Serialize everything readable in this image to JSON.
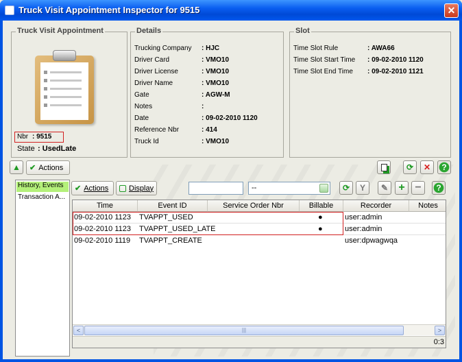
{
  "window": {
    "title": "Truck Visit Appointment Inspector for 9515",
    "close_glyph": "✕"
  },
  "appointment": {
    "legend": "Truck Visit Appointment",
    "nbr_label": "Nbr",
    "nbr_value": ": 9515",
    "state_label": "State",
    "state_value": ": UsedLate"
  },
  "details": {
    "legend": "Details",
    "fields": [
      {
        "label": "Trucking Company",
        "value": ": HJC"
      },
      {
        "label": "Driver Card",
        "value": ": VMO10"
      },
      {
        "label": "Driver License",
        "value": ": VMO10"
      },
      {
        "label": "Driver Name",
        "value": ": VMO10"
      },
      {
        "label": "Gate",
        "value": ": AGW-M"
      },
      {
        "label": "Notes",
        "value": ":"
      },
      {
        "label": "Date",
        "value": ": 09-02-2010 1120"
      },
      {
        "label": "Reference Nbr",
        "value": ": 414"
      },
      {
        "label": "Truck Id",
        "value": ": VMO10"
      }
    ]
  },
  "slot": {
    "legend": "Slot",
    "fields": [
      {
        "label": "Time Slot Rule",
        "value": ": AWA66"
      },
      {
        "label": "Time Slot Start Time",
        "value": ": 09-02-2010 1120"
      },
      {
        "label": "Time Slot End Time",
        "value": ": 09-02-2010 1121"
      }
    ]
  },
  "toolbar": {
    "collapse_glyph": "▲",
    "actions_label": "Actions",
    "refresh_glyph": "⟳",
    "delete_glyph": "✕",
    "help_glyph": "?"
  },
  "nav": {
    "items": [
      {
        "label": "History, Events"
      },
      {
        "label": "Transaction A..."
      }
    ]
  },
  "panel_toolbar": {
    "actions_label": "Actions",
    "display_label": "Display",
    "filter_value": "",
    "combo_value": "--",
    "refresh_glyph": "⟳",
    "filter_glyph": "Y",
    "edit_glyph": "✎",
    "add_glyph": "+",
    "remove_glyph": "−",
    "help_glyph": "?"
  },
  "table": {
    "columns": [
      "Time",
      "Event ID",
      "Service Order Nbr",
      "Billable",
      "Recorder",
      "Notes"
    ],
    "rows": [
      {
        "time": "09-02-2010 1123",
        "event_id": "TVAPPT_USED",
        "service_order": "",
        "billable": "●",
        "recorder": "user:admin",
        "notes": ""
      },
      {
        "time": "09-02-2010 1123",
        "event_id": "TVAPPT_USED_LATE",
        "service_order": "",
        "billable": "●",
        "recorder": "user:admin",
        "notes": ""
      },
      {
        "time": "09-02-2010 1119",
        "event_id": "TVAPPT_CREATE",
        "service_order": "",
        "billable": "",
        "recorder": "user:dpwagwqa",
        "notes": ""
      }
    ],
    "scroll_left": "<",
    "scroll_right": ">",
    "scroll_grip": "|||",
    "count": "0:3"
  },
  "colors": {
    "title_blue": "#0054e3",
    "highlight_red": "#d21f1f",
    "nav_selected": "#b4f07a",
    "icon_green": "#1f9a24"
  }
}
